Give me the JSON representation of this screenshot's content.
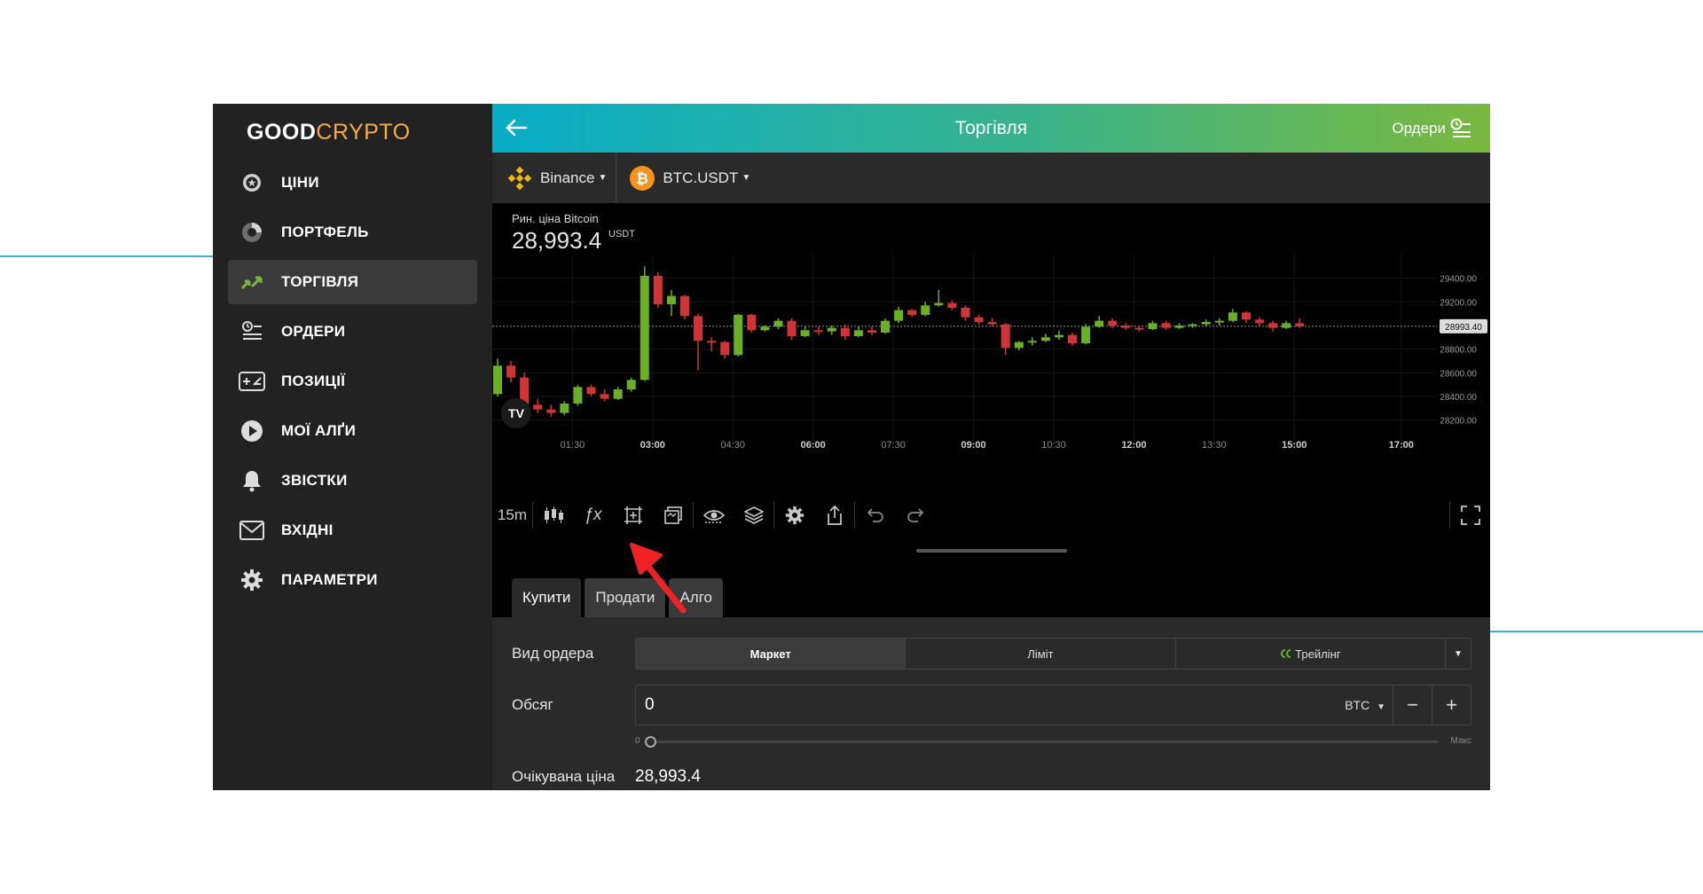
{
  "logo": {
    "good": "GOOD",
    "crypto": "CRYPTO"
  },
  "sidebar": {
    "items": [
      {
        "label": "ЦІНИ",
        "icon": "coin-icon"
      },
      {
        "label": "ПОРТФЕЛЬ",
        "icon": "pie-chart-icon"
      },
      {
        "label": "ТОРГІВЛЯ",
        "icon": "trade-arrows-icon",
        "active": true
      },
      {
        "label": "ОРДЕРИ",
        "icon": "orders-list-icon"
      },
      {
        "label": "ПОЗИЦІЇ",
        "icon": "positions-icon"
      },
      {
        "label": "МОЇ АЛҐИ",
        "icon": "play-icon"
      },
      {
        "label": "ЗВІСТКИ",
        "icon": "bell-icon"
      },
      {
        "label": "ВХІДНІ",
        "icon": "mail-icon"
      },
      {
        "label": "ПАРАМЕТРИ",
        "icon": "gear-icon"
      }
    ]
  },
  "header": {
    "title": "Торгівля",
    "orders_link": "Ордери"
  },
  "pair_bar": {
    "exchange": "Binance",
    "pair": "BTC.USDT"
  },
  "chart": {
    "price_label": "Рин. ціна Bitcoin",
    "price": "28,993.4",
    "unit": "USDT",
    "current_price_tag": "28993.40",
    "y_ticks": [
      "29400.00",
      "29200.00",
      "28800.00",
      "28600.00",
      "28400.00",
      "28200.00"
    ],
    "x_ticks": [
      "01:30",
      "03:00",
      "04:30",
      "06:00",
      "07:30",
      "09:00",
      "10:30",
      "12:00",
      "13:30",
      "15:00",
      "17:00"
    ],
    "bold_x_ticks": [
      "03:00",
      "06:00",
      "09:00",
      "12:00",
      "15:00",
      "17:00"
    ],
    "logo_text": "TV"
  },
  "chart_data": {
    "type": "candlestick",
    "interval": "15m",
    "ylim": [
      28100,
      29600
    ],
    "current_price": 28993.4,
    "up_color": "#6ab025",
    "down_color": "#d03436",
    "candles": [
      {
        "t": "00:00",
        "o": 28420,
        "h": 28720,
        "l": 28400,
        "c": 28660
      },
      {
        "t": "00:15",
        "o": 28660,
        "h": 28700,
        "l": 28520,
        "c": 28560
      },
      {
        "t": "00:30",
        "o": 28560,
        "h": 28600,
        "l": 28280,
        "c": 28330
      },
      {
        "t": "00:45",
        "o": 28330,
        "h": 28380,
        "l": 28260,
        "c": 28290
      },
      {
        "t": "01:00",
        "o": 28290,
        "h": 28330,
        "l": 28230,
        "c": 28260
      },
      {
        "t": "01:15",
        "o": 28260,
        "h": 28360,
        "l": 28240,
        "c": 28340
      },
      {
        "t": "01:30",
        "o": 28340,
        "h": 28500,
        "l": 28320,
        "c": 28480
      },
      {
        "t": "01:45",
        "o": 28480,
        "h": 28500,
        "l": 28400,
        "c": 28420
      },
      {
        "t": "02:00",
        "o": 28420,
        "h": 28460,
        "l": 28360,
        "c": 28380
      },
      {
        "t": "02:15",
        "o": 28380,
        "h": 28480,
        "l": 28370,
        "c": 28460
      },
      {
        "t": "02:30",
        "o": 28460,
        "h": 28560,
        "l": 28440,
        "c": 28540
      },
      {
        "t": "02:45",
        "o": 28540,
        "h": 29500,
        "l": 28530,
        "c": 29420
      },
      {
        "t": "03:00",
        "o": 29420,
        "h": 29450,
        "l": 29150,
        "c": 29180
      },
      {
        "t": "03:15",
        "o": 29180,
        "h": 29300,
        "l": 29080,
        "c": 29250
      },
      {
        "t": "03:30",
        "o": 29250,
        "h": 29260,
        "l": 29050,
        "c": 29080
      },
      {
        "t": "03:45",
        "o": 29080,
        "h": 29100,
        "l": 28620,
        "c": 28870
      },
      {
        "t": "04:00",
        "o": 28870,
        "h": 28900,
        "l": 28780,
        "c": 28860
      },
      {
        "t": "04:15",
        "o": 28860,
        "h": 28870,
        "l": 28720,
        "c": 28750
      },
      {
        "t": "04:30",
        "o": 28750,
        "h": 29100,
        "l": 28740,
        "c": 29090
      },
      {
        "t": "04:45",
        "o": 29090,
        "h": 29100,
        "l": 28940,
        "c": 28960
      },
      {
        "t": "05:00",
        "o": 28960,
        "h": 29000,
        "l": 28950,
        "c": 28990
      },
      {
        "t": "05:15",
        "o": 28990,
        "h": 29060,
        "l": 28970,
        "c": 29040
      },
      {
        "t": "05:30",
        "o": 29040,
        "h": 29060,
        "l": 28880,
        "c": 28910
      },
      {
        "t": "05:45",
        "o": 28910,
        "h": 28990,
        "l": 28900,
        "c": 28960
      },
      {
        "t": "06:00",
        "o": 28960,
        "h": 28990,
        "l": 28920,
        "c": 28950
      },
      {
        "t": "06:15",
        "o": 28950,
        "h": 29000,
        "l": 28920,
        "c": 28980
      },
      {
        "t": "06:30",
        "o": 28980,
        "h": 29010,
        "l": 28880,
        "c": 28910
      },
      {
        "t": "06:45",
        "o": 28910,
        "h": 28990,
        "l": 28900,
        "c": 28960
      },
      {
        "t": "07:00",
        "o": 28960,
        "h": 28990,
        "l": 28920,
        "c": 28940
      },
      {
        "t": "07:15",
        "o": 28940,
        "h": 29060,
        "l": 28930,
        "c": 29040
      },
      {
        "t": "07:30",
        "o": 29040,
        "h": 29160,
        "l": 29020,
        "c": 29130
      },
      {
        "t": "07:45",
        "o": 29130,
        "h": 29140,
        "l": 29070,
        "c": 29090
      },
      {
        "t": "08:00",
        "o": 29090,
        "h": 29200,
        "l": 29080,
        "c": 29170
      },
      {
        "t": "08:15",
        "o": 29170,
        "h": 29300,
        "l": 29160,
        "c": 29190
      },
      {
        "t": "08:30",
        "o": 29190,
        "h": 29210,
        "l": 29130,
        "c": 29150
      },
      {
        "t": "08:45",
        "o": 29150,
        "h": 29170,
        "l": 29040,
        "c": 29070
      },
      {
        "t": "09:00",
        "o": 29070,
        "h": 29090,
        "l": 29010,
        "c": 29030
      },
      {
        "t": "09:15",
        "o": 29030,
        "h": 29060,
        "l": 28990,
        "c": 29010
      },
      {
        "t": "09:30",
        "o": 29010,
        "h": 29020,
        "l": 28750,
        "c": 28810
      },
      {
        "t": "09:45",
        "o": 28810,
        "h": 28870,
        "l": 28790,
        "c": 28860
      },
      {
        "t": "10:00",
        "o": 28860,
        "h": 28900,
        "l": 28830,
        "c": 28870
      },
      {
        "t": "10:15",
        "o": 28870,
        "h": 28930,
        "l": 28860,
        "c": 28900
      },
      {
        "t": "10:30",
        "o": 28900,
        "h": 28960,
        "l": 28880,
        "c": 28920
      },
      {
        "t": "10:45",
        "o": 28920,
        "h": 28940,
        "l": 28830,
        "c": 28850
      },
      {
        "t": "11:00",
        "o": 28850,
        "h": 29010,
        "l": 28840,
        "c": 28990
      },
      {
        "t": "11:15",
        "o": 28990,
        "h": 29080,
        "l": 28980,
        "c": 29040
      },
      {
        "t": "11:30",
        "o": 29040,
        "h": 29060,
        "l": 28980,
        "c": 29000
      },
      {
        "t": "11:45",
        "o": 29000,
        "h": 29020,
        "l": 28960,
        "c": 28980
      },
      {
        "t": "12:00",
        "o": 28980,
        "h": 29000,
        "l": 28950,
        "c": 28970
      },
      {
        "t": "12:15",
        "o": 28970,
        "h": 29040,
        "l": 28960,
        "c": 29020
      },
      {
        "t": "12:30",
        "o": 29020,
        "h": 29040,
        "l": 28960,
        "c": 28980
      },
      {
        "t": "12:45",
        "o": 28980,
        "h": 29020,
        "l": 28970,
        "c": 29000
      },
      {
        "t": "13:00",
        "o": 29000,
        "h": 29020,
        "l": 28980,
        "c": 29010
      },
      {
        "t": "13:15",
        "o": 29010,
        "h": 29050,
        "l": 28990,
        "c": 29030
      },
      {
        "t": "13:30",
        "o": 29030,
        "h": 29060,
        "l": 29000,
        "c": 29040
      },
      {
        "t": "13:45",
        "o": 29040,
        "h": 29140,
        "l": 29030,
        "c": 29110
      },
      {
        "t": "14:00",
        "o": 29110,
        "h": 29120,
        "l": 29020,
        "c": 29050
      },
      {
        "t": "14:15",
        "o": 29050,
        "h": 29070,
        "l": 28990,
        "c": 29020
      },
      {
        "t": "14:30",
        "o": 29020,
        "h": 29040,
        "l": 28950,
        "c": 28980
      },
      {
        "t": "14:45",
        "o": 28980,
        "h": 29040,
        "l": 28970,
        "c": 29020
      },
      {
        "t": "15:00",
        "o": 29020,
        "h": 29060,
        "l": 28980,
        "c": 28993
      }
    ],
    "xlim": [
      "00:00",
      "17:40"
    ]
  },
  "toolbar": {
    "interval": "15m",
    "items": [
      {
        "name": "candles-type-icon"
      },
      {
        "name": "indicators-icon",
        "label": "ƒx"
      },
      {
        "name": "crosshair-frame-icon"
      },
      {
        "name": "compare-icon"
      },
      {
        "name": "visibility-icon"
      },
      {
        "name": "layers-icon"
      },
      {
        "name": "gear-icon"
      },
      {
        "name": "share-icon"
      },
      {
        "name": "undo-icon"
      },
      {
        "name": "redo-icon"
      },
      {
        "name": "fullscreen-icon"
      }
    ]
  },
  "tabs": [
    {
      "label": "Купити",
      "active": true
    },
    {
      "label": "Продати"
    },
    {
      "label": "Алго"
    }
  ],
  "order": {
    "type_label": "Вид ордера",
    "types": [
      "Маркет",
      "Ліміт",
      "Трейлінг"
    ],
    "qty_label": "Обсяг",
    "qty_value": "0",
    "qty_unit": "BTC",
    "slider_min": "0",
    "slider_max": "Макс",
    "slider_value": 0,
    "expected_label": "Очікувана ціна",
    "expected_value": "28,993.4"
  },
  "colors": {
    "accent_teal": "#08adc7",
    "accent_green": "#7ab83e",
    "logo_orange": "#f6ad3c",
    "annotation_arrow": "#ee2222"
  }
}
